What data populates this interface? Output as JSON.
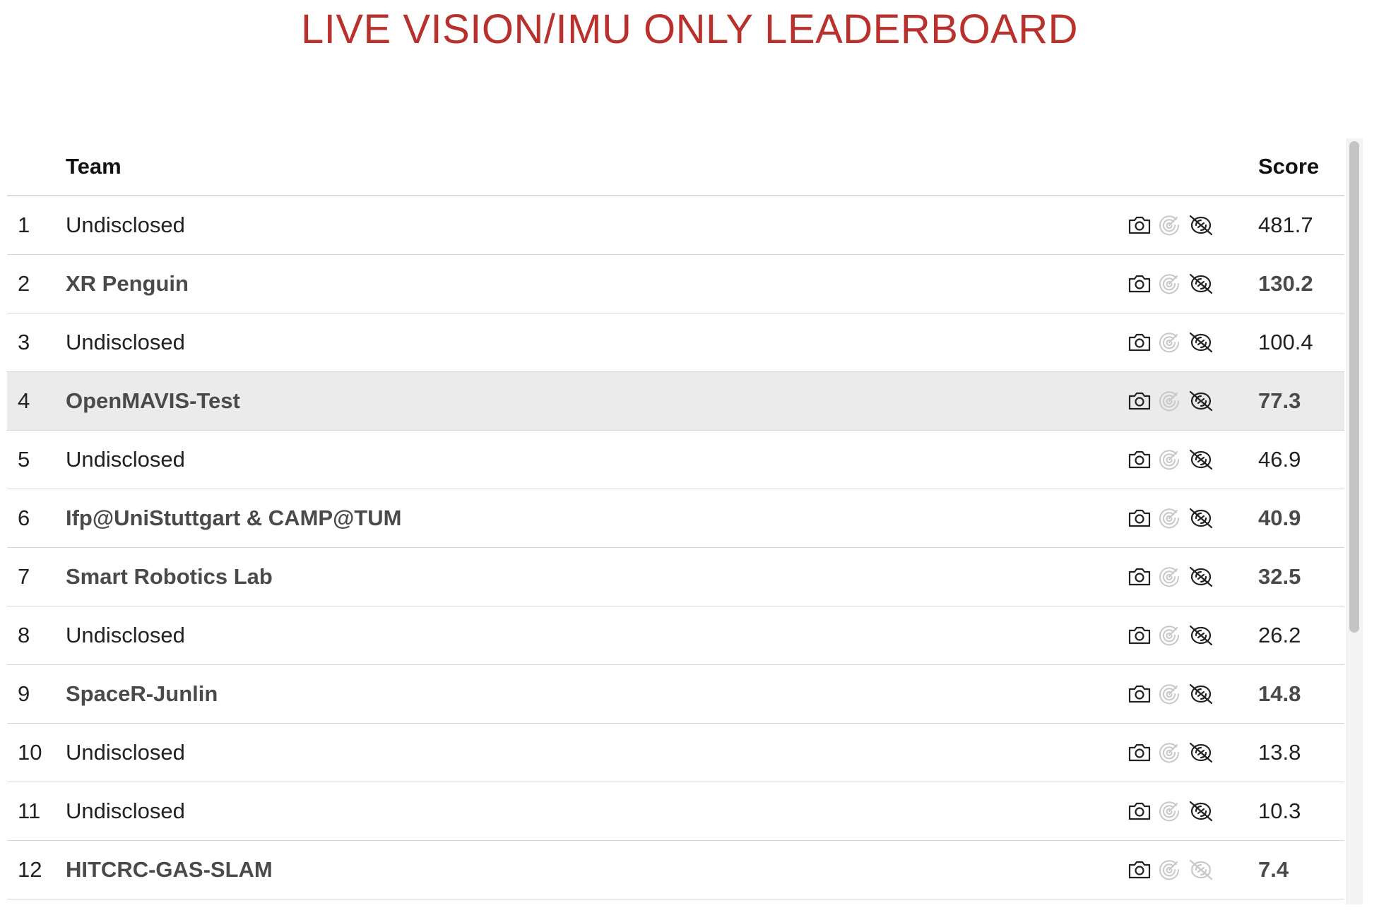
{
  "title": "LIVE VISION/IMU ONLY LEADERBOARD",
  "table": {
    "columns": {
      "rank": "",
      "team": "Team",
      "sensors": "",
      "score": "Score"
    },
    "rows": [
      {
        "rank": "1",
        "team": "Undisclosed",
        "score": "481.7",
        "linked": false,
        "highlight": false,
        "icons": [
          "camera-icon",
          "radar-disabled-icon",
          "no-lidar-icon"
        ]
      },
      {
        "rank": "2",
        "team": "XR Penguin",
        "score": "130.2",
        "linked": true,
        "highlight": false,
        "icons": [
          "camera-icon",
          "radar-disabled-icon",
          "no-lidar-icon"
        ]
      },
      {
        "rank": "3",
        "team": "Undisclosed",
        "score": "100.4",
        "linked": false,
        "highlight": false,
        "icons": [
          "camera-icon",
          "radar-disabled-icon",
          "no-lidar-icon"
        ]
      },
      {
        "rank": "4",
        "team": "OpenMAVIS-Test",
        "score": "77.3",
        "linked": true,
        "highlight": true,
        "icons": [
          "camera-icon",
          "radar-disabled-icon",
          "no-lidar-icon"
        ]
      },
      {
        "rank": "5",
        "team": "Undisclosed",
        "score": "46.9",
        "linked": false,
        "highlight": false,
        "icons": [
          "camera-icon",
          "radar-disabled-icon",
          "no-lidar-icon"
        ]
      },
      {
        "rank": "6",
        "team": "Ifp@UniStuttgart & CAMP@TUM",
        "score": "40.9",
        "linked": true,
        "highlight": false,
        "icons": [
          "camera-icon",
          "radar-disabled-icon",
          "no-lidar-icon"
        ]
      },
      {
        "rank": "7",
        "team": "Smart Robotics Lab",
        "score": "32.5",
        "linked": true,
        "highlight": false,
        "icons": [
          "camera-icon",
          "radar-disabled-icon",
          "no-lidar-icon"
        ]
      },
      {
        "rank": "8",
        "team": "Undisclosed",
        "score": "26.2",
        "linked": false,
        "highlight": false,
        "icons": [
          "camera-icon",
          "radar-disabled-icon",
          "no-lidar-icon"
        ]
      },
      {
        "rank": "9",
        "team": "SpaceR-Junlin",
        "score": "14.8",
        "linked": true,
        "highlight": false,
        "icons": [
          "camera-icon",
          "radar-disabled-icon",
          "no-lidar-icon"
        ]
      },
      {
        "rank": "10",
        "team": "Undisclosed",
        "score": "13.8",
        "linked": false,
        "highlight": false,
        "icons": [
          "camera-icon",
          "radar-disabled-icon",
          "no-lidar-icon"
        ]
      },
      {
        "rank": "11",
        "team": "Undisclosed",
        "score": "10.3",
        "linked": false,
        "highlight": false,
        "icons": [
          "camera-icon",
          "radar-disabled-icon",
          "no-lidar-icon"
        ]
      },
      {
        "rank": "12",
        "team": "HITCRC-GAS-SLAM",
        "score": "7.4",
        "linked": true,
        "highlight": false,
        "icons": [
          "camera-icon",
          "radar-disabled-icon",
          "no-lidar-disabled-icon"
        ]
      }
    ]
  },
  "colors": {
    "title": "#b8312c",
    "highlight_row": "#ebebeb",
    "linked_text": "#4a4a4a",
    "plain_text": "#222222",
    "icon_active": "#222222",
    "icon_disabled": "#c8c8c8"
  }
}
